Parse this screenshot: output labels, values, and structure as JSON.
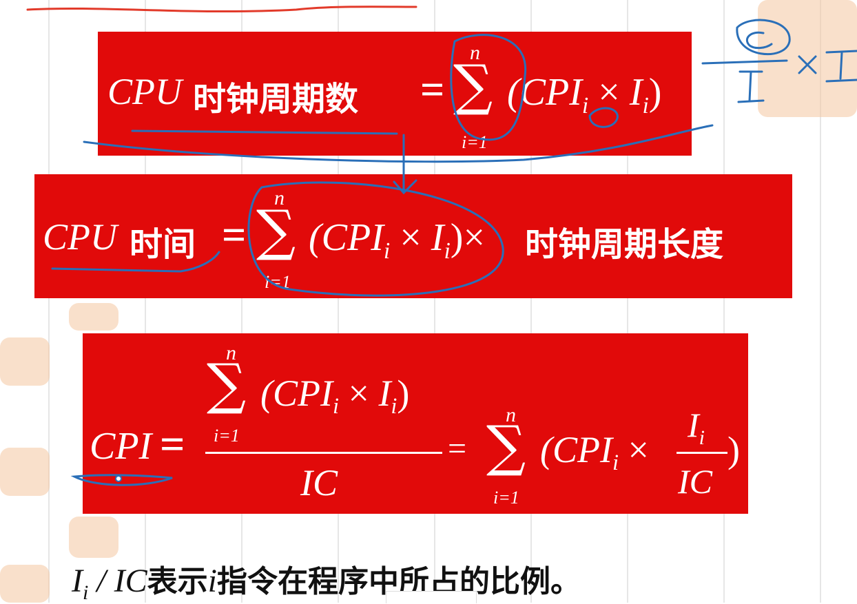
{
  "formula1": {
    "lhs_var": "CPU",
    "lhs_text": "时钟周期数",
    "eq": "=",
    "sum_top": "n",
    "sum_bottom": "i=1",
    "sigma": "∑",
    "body_open": "(CPI",
    "sub1": "i",
    "times": "×",
    "i_var": "I",
    "sub2": "i",
    "body_close": ")"
  },
  "formula2": {
    "lhs_var": "CPU",
    "lhs_text": "时间",
    "eq": "=",
    "sum_top": "n",
    "sum_bottom": "i=1",
    "sigma": "∑",
    "body_open": "(CPI",
    "sub1": "i",
    "times": "×",
    "i_var": "I",
    "sub2": "i",
    "body_close": ")",
    "times2": "×",
    "rhs_text": "时钟周期长度"
  },
  "formula3": {
    "lhs_var": "CPI",
    "eq": "=",
    "num_sum_top": "n",
    "num_sum_bottom": "i=1",
    "sigma": "∑",
    "num_body_open": "(CPI",
    "num_sub1": "i",
    "times": "×",
    "i_var": "I",
    "num_sub2": "i",
    "num_body_close": ")",
    "denominator": "IC",
    "eq2": "=",
    "rhs_sum_top": "n",
    "rhs_sum_bottom": "i=1",
    "rhs_body_open": "(CPI",
    "rhs_sub1": "i",
    "rhs_times": "×",
    "rhs_frac_num": "I",
    "rhs_frac_num_sub": "i",
    "rhs_frac_den": "IC",
    "rhs_close": ")"
  },
  "footnote": {
    "var": "I",
    "sub": "i",
    "slash_ic": " / IC",
    "text1": "表示",
    "i_letter": "i",
    "text2": "指令在程序中所占的比例。"
  },
  "handwriting": {
    "note_c": "C",
    "note_i": "I",
    "note_times": "×",
    "note_i2": "I"
  },
  "colors": {
    "box_red": "#e10a0a",
    "ink_blue": "#2a6fb8",
    "text_white": "#ffffff"
  }
}
